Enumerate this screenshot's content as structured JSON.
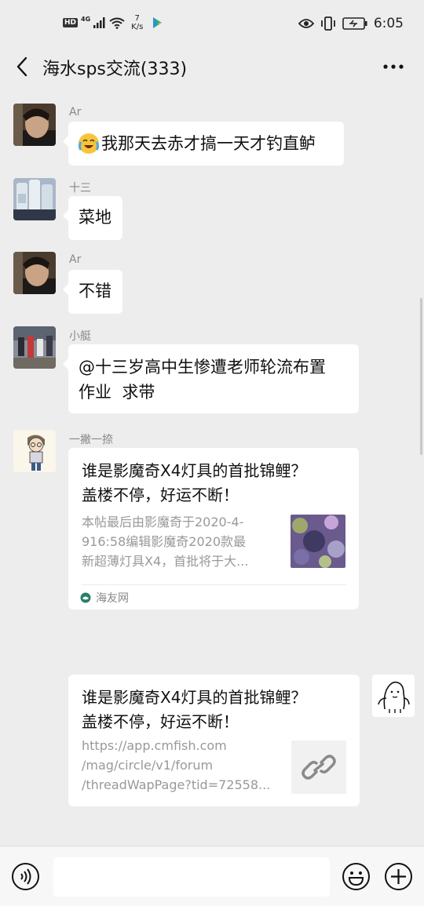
{
  "status_bar": {
    "hd": "HD",
    "network": "4G",
    "speed_value": "7",
    "speed_unit": "K/s",
    "time": "6:05"
  },
  "header": {
    "title": "海水sps交流(333)"
  },
  "messages": [
    {
      "sender": "Ar",
      "text": "我那天去赤才搞一天才钓直鲈",
      "emoji": "cry-laugh-emoji"
    },
    {
      "sender": "十三",
      "text": "菜地"
    },
    {
      "sender": "Ar",
      "text": "不错"
    },
    {
      "sender": "小艇",
      "text_line1": "@十三岁高中生惨遭老师轮流布置",
      "text_line2": "作业  求带"
    },
    {
      "sender": "一撇一捺",
      "card_title_line1": "谁是影魔奇X4灯具的首批锦鲤？",
      "card_title_line2": "盖楼不停，好运不断！",
      "card_desc_line1": "本帖最后由影魔奇于2020-4-",
      "card_desc_line2": "916:58编辑影魔奇2020款最",
      "card_desc_line3": "新超薄灯具X4，首批将于大...",
      "source": "海友网"
    }
  ],
  "own_message": {
    "card_title_line1": "谁是影魔奇X4灯具的首批锦鲤？",
    "card_title_line2": "盖楼不停，好运不断！",
    "url_line1": "https://app.cmfish.com",
    "url_line2": "/mag/circle/v1/forum",
    "url_line3": "/threadWapPage?tid=72558..."
  },
  "input_bar": {
    "placeholder": ""
  },
  "colors": {
    "background": "#ededed",
    "bubble": "#ffffff",
    "muted_text": "#999999"
  }
}
